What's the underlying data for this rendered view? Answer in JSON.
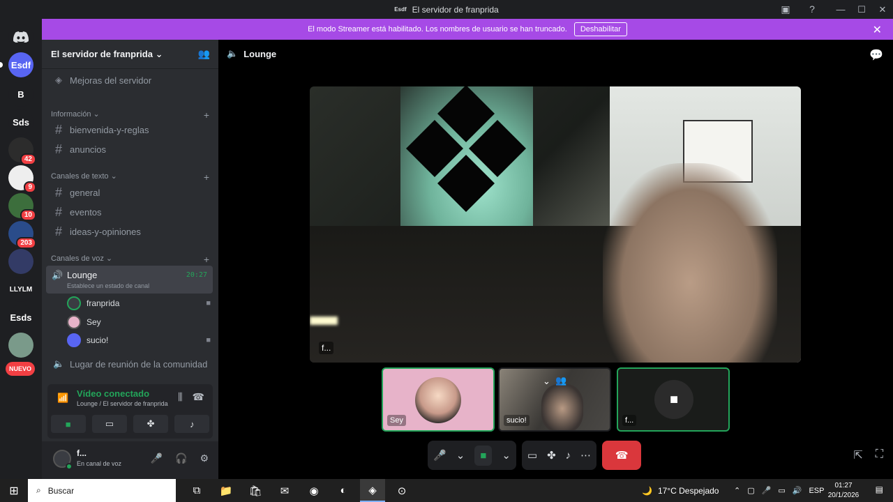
{
  "window": {
    "logo_text": "Esdf",
    "title": "El servidor de franprida",
    "minimize": "—",
    "maximize": "☐",
    "close": "✕"
  },
  "rail": [
    {
      "label": "Esdf",
      "bg": "#5865f2"
    },
    {
      "label": "B",
      "bg": "#1e1f22"
    },
    {
      "label": "Sds",
      "bg": "#1e1f22"
    },
    {
      "label": "",
      "bg": "#2c2c2c",
      "badge": "42"
    },
    {
      "label": "",
      "bg": "#eeeeee",
      "badge": "9"
    },
    {
      "label": "",
      "bg": "#3c6e3c",
      "badge": "10"
    },
    {
      "label": "",
      "bg": "#2a4c8a",
      "badge": "203"
    },
    {
      "label": "",
      "bg": "#333b66"
    },
    {
      "label": "LLYLM",
      "bg": "#1e1f22"
    },
    {
      "label": "Esds",
      "bg": "#1e1f22"
    },
    {
      "label": "",
      "bg": "#7a9a8a"
    },
    {
      "label": "NUEVO",
      "bg": "#f23f43"
    }
  ],
  "banner": {
    "text": "El modo Streamer está habilitado. Los nombres de usuario se han truncado.",
    "button": "Deshabilitar"
  },
  "sidebar": {
    "server_name": "El servidor de franprida",
    "boost": "Mejoras del servidor",
    "categories": {
      "info": "Información",
      "text": "Canales de texto",
      "voice": "Canales de voz"
    },
    "channels": {
      "welcome": "bienvenida-y-reglas",
      "announcements": "anuncios",
      "general": "general",
      "events": "eventos",
      "ideas": "ideas-y-opiniones"
    },
    "lounge": {
      "name": "Lounge",
      "status": "Establece un estado de canal",
      "time": "20:27"
    },
    "voice_users": [
      "franprida",
      "Sey",
      "sucio!"
    ],
    "community": "Lugar de reunión de la comunidad"
  },
  "voice_panel": {
    "status": "Vídeo conectado",
    "location": "Lounge / El servidor de franprida"
  },
  "user": {
    "name": "f...",
    "status": "En canal de voz"
  },
  "main": {
    "channel": "Lounge",
    "main_label": "f...",
    "tiles": [
      {
        "label": "Sey",
        "bg": "#e7b3c9"
      },
      {
        "label": "sucio!",
        "bg": "#55524e"
      },
      {
        "label": "f...",
        "bg": "#1a1c1a"
      }
    ]
  },
  "taskbar": {
    "search": "Buscar",
    "weather": "17°C  Despejado",
    "lang": "ESP",
    "time": "01:27",
    "date": "20/1/2026"
  }
}
